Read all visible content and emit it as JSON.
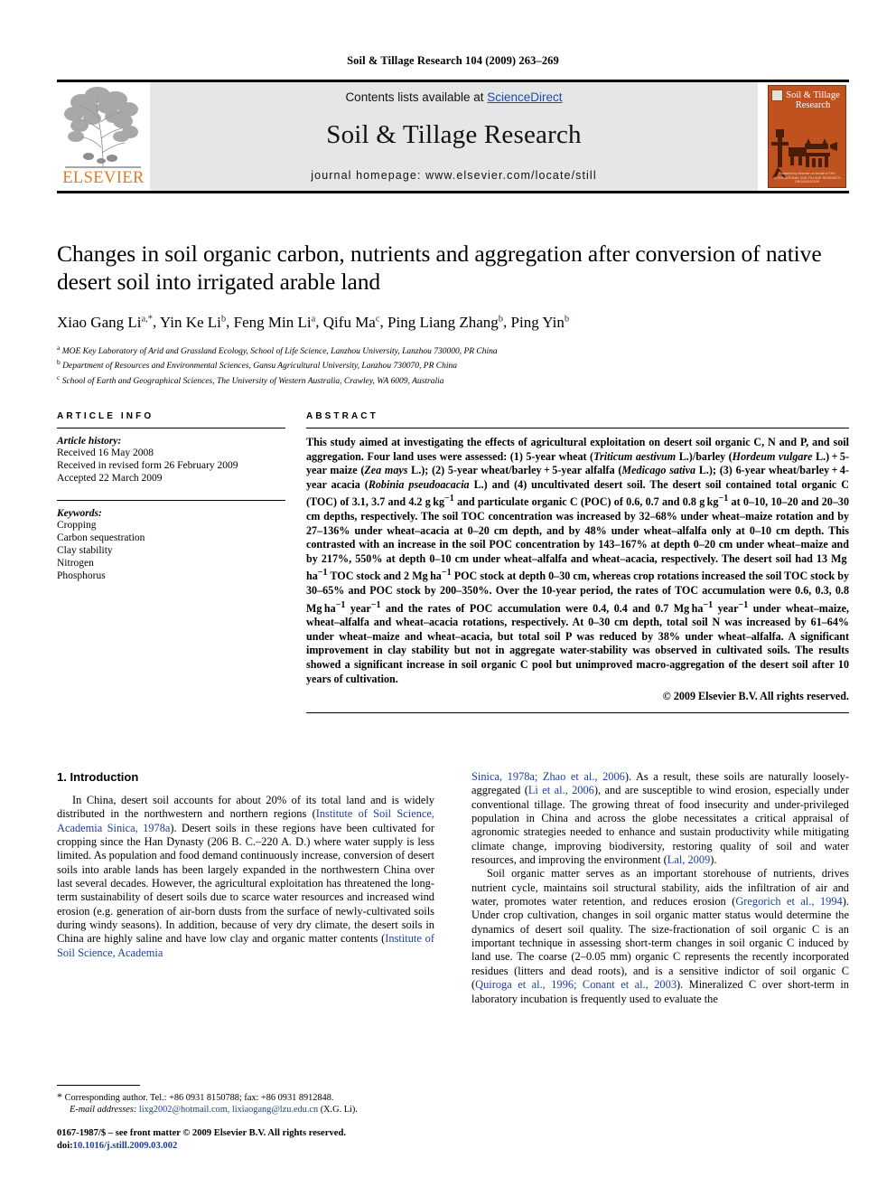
{
  "running_head": "Soil & Tillage Research 104 (2009) 263–269",
  "masthead": {
    "contents_prefix": "Contents lists available at ",
    "sciencedirect": "ScienceDirect",
    "journal_name": "Soil & Tillage Research",
    "homepage": "journal homepage: www.elsevier.com/locate/still",
    "publisher_wordmark": "ELSEVIER",
    "cover_title": "Soil & Tillage Research",
    "cover_caption": "Published by Elsevier on behalf of THE INTERNATIONAL SOIL TILLAGE RESEARCH ORGANIZATION",
    "cover_color": "#c0521f",
    "link_color": "#1a4bbd",
    "elsevier_orange": "#e87722"
  },
  "article": {
    "title": "Changes in soil organic carbon, nutrients and aggregation after conversion of native desert soil into irrigated arable land",
    "authors": [
      {
        "name": "Xiao Gang Li",
        "marks": "a,*"
      },
      {
        "name": "Yin Ke Li",
        "marks": "b"
      },
      {
        "name": "Feng Min Li",
        "marks": "a"
      },
      {
        "name": "Qifu Ma",
        "marks": "c"
      },
      {
        "name": "Ping Liang Zhang",
        "marks": "b"
      },
      {
        "name": "Ping Yin",
        "marks": "b"
      }
    ],
    "affiliations": [
      {
        "mark": "a",
        "text": "MOE Key Laboratory of Arid and Grassland Ecology, School of Life Science, Lanzhou University, Lanzhou 730000, PR China"
      },
      {
        "mark": "b",
        "text": "Department of Resources and Environmental Sciences, Gansu Agricultural University, Lanzhou 730070, PR China"
      },
      {
        "mark": "c",
        "text": "School of Earth and Geographical Sciences, The University of Western Australia, Crawley, WA 6009, Australia"
      }
    ]
  },
  "article_info": {
    "heading": "ARTICLE INFO",
    "history_label": "Article history:",
    "history": [
      "Received 16 May 2008",
      "Received in revised form 26 February 2009",
      "Accepted 22 March 2009"
    ],
    "keywords_label": "Keywords:",
    "keywords": [
      "Cropping",
      "Carbon sequestration",
      "Clay stability",
      "Nitrogen",
      "Phosphorus"
    ]
  },
  "abstract": {
    "heading": "ABSTRACT",
    "copyright": "© 2009 Elsevier B.V. All rights reserved."
  },
  "introduction": {
    "heading": "1. Introduction"
  },
  "footnote": {
    "corresponding": "Corresponding author. Tel.: +86 0931 8150788; fax: +86 0931 8912848.",
    "email_label": "E-mail addresses:",
    "emails": "lixg2002@hotmail.com, lixiaogang@lzu.edu.cn",
    "email_owner": "(X.G. Li)."
  },
  "page_footer": {
    "issn_line": "0167-1987/$ – see front matter © 2009 Elsevier B.V. All rights reserved.",
    "doi_label": "doi:",
    "doi": "10.1016/j.still.2009.03.002"
  }
}
